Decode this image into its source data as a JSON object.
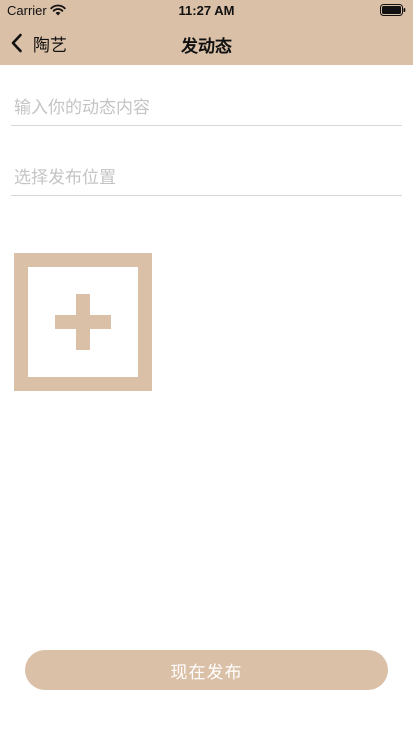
{
  "status_bar": {
    "carrier": "Carrier",
    "time": "11:27 AM"
  },
  "nav": {
    "back_label": "陶艺",
    "title": "发动态"
  },
  "form": {
    "content_placeholder": "输入你的动态内容",
    "location_placeholder": "选择发布位置",
    "content_value": "",
    "location_value": ""
  },
  "icons": {
    "back": "chevron-left-icon",
    "add_photo": "plus-icon",
    "wifi": "wifi-icon",
    "battery": "battery-icon"
  },
  "actions": {
    "publish_label": "现在发布"
  },
  "colors": {
    "accent": "#dbc0a8",
    "placeholder": "#c4c4c4",
    "divider": "#d6d6d6"
  }
}
